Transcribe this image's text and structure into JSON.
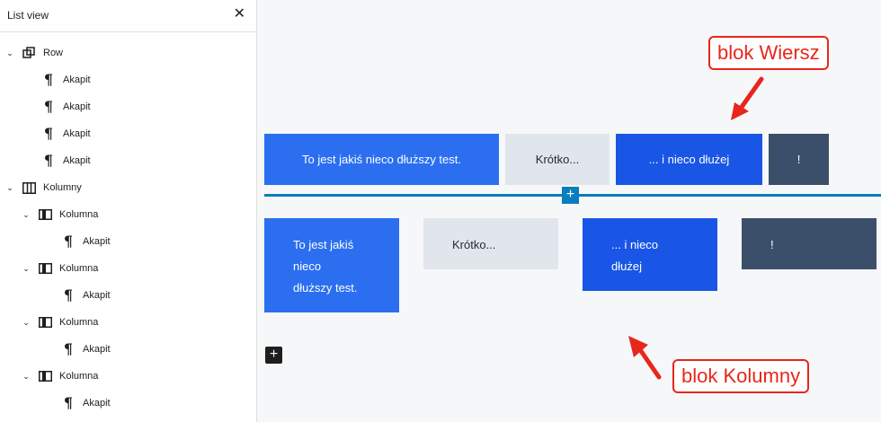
{
  "sidebar": {
    "title": "List view",
    "close_glyph": "✕",
    "items": [
      {
        "label": "Row",
        "icon": "row-icon",
        "chevron": "⌄"
      },
      {
        "label": "Akapit",
        "icon": "paragraph-icon"
      },
      {
        "label": "Akapit",
        "icon": "paragraph-icon"
      },
      {
        "label": "Akapit",
        "icon": "paragraph-icon"
      },
      {
        "label": "Akapit",
        "icon": "paragraph-icon"
      },
      {
        "label": "Kolumny",
        "icon": "columns-icon",
        "chevron": "⌄"
      },
      {
        "label": "Kolumna",
        "icon": "column-icon",
        "chevron": "⌄"
      },
      {
        "label": "Akapit",
        "icon": "paragraph-icon"
      },
      {
        "label": "Kolumna",
        "icon": "column-icon",
        "chevron": "⌄"
      },
      {
        "label": "Akapit",
        "icon": "paragraph-icon"
      },
      {
        "label": "Kolumna",
        "icon": "column-icon",
        "chevron": "⌄"
      },
      {
        "label": "Akapit",
        "icon": "paragraph-icon"
      },
      {
        "label": "Kolumna",
        "icon": "column-icon",
        "chevron": "⌄"
      },
      {
        "label": "Akapit",
        "icon": "paragraph-icon"
      }
    ],
    "pilcrow": "¶"
  },
  "row_block": {
    "items": [
      "To jest jakiś nieco dłuższy test.",
      "Krótko...",
      "... i nieco dłużej",
      "!"
    ]
  },
  "columns_block": {
    "col1": [
      "To jest jakiś",
      "nieco",
      "dłuższy test."
    ],
    "col2": "Krótko...",
    "col3": [
      "... i nieco",
      "dłużej"
    ],
    "col4": "!"
  },
  "insert_plus": "+",
  "add_block": "+",
  "annotations": {
    "row_label": "blok Wiersz",
    "columns_label": "blok Kolumny"
  },
  "colors": {
    "blue": "#2b6ff0",
    "dark_blue": "#1a56e6",
    "light": "#e1e6ec",
    "slate": "#3c4f6a",
    "accent": "#0a7dbd",
    "annotation": "#e8261c"
  }
}
